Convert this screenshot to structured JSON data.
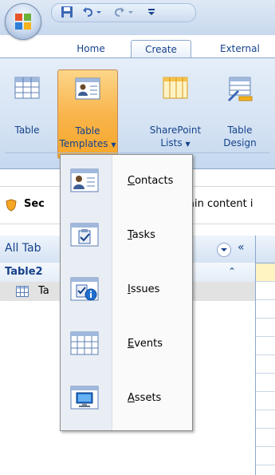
{
  "tabs": {
    "home": "Home",
    "create": "Create",
    "external": "External"
  },
  "ribbon": {
    "table": "Table",
    "table_templates_1": "Table",
    "table_templates_2": "Templates",
    "sharepoint_1": "SharePoint",
    "sharepoint_2": "Lists",
    "table_design_1": "Table",
    "table_design_2": "Design"
  },
  "security": {
    "prefix": "Sec",
    "suffix": "ain content i"
  },
  "nav": {
    "title": "All Tab",
    "group": "Table2",
    "item": "Ta"
  },
  "menu": {
    "contacts_key": "C",
    "contacts_rest": "ontacts",
    "tasks_key": "T",
    "tasks_rest": "asks",
    "issues_key": "I",
    "issues_rest": "ssues",
    "events_key": "E",
    "events_rest": "vents",
    "assets_key": "A",
    "assets_rest": "ssets"
  },
  "colors": {
    "ribbon_text": "#15428b",
    "pressed_fill": "#f9b54c"
  }
}
